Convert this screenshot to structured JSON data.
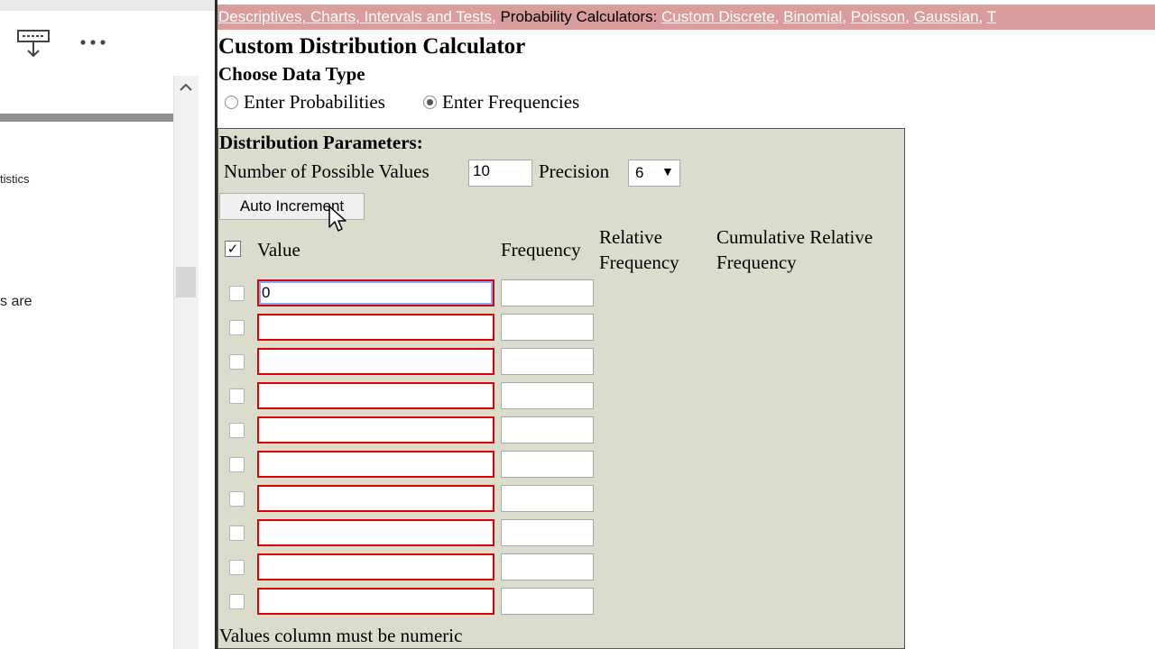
{
  "nav": {
    "link_descriptives": "Descriptives, Charts, Intervals and Tests",
    "prob_calc_label": "Probability Calculators:",
    "link_custom_discrete": "Custom Discrete",
    "link_binomial": "Binomial",
    "link_poisson": "Poisson",
    "link_gaussian": "Gaussian",
    "link_t": "T"
  },
  "page": {
    "title": "Custom Distribution Calculator",
    "data_type_heading": "Choose Data Type",
    "radio_probabilities": "Enter Probabilities",
    "radio_frequencies": "Enter Frequencies",
    "selected_data_type": "Enter Frequencies"
  },
  "params": {
    "heading": "Distribution Parameters:",
    "num_values_label": "Number of Possible Values",
    "num_values": "10",
    "precision_label": "Precision",
    "precision_value": "6",
    "auto_increment_label": "Auto Increment"
  },
  "table": {
    "header_checked": true,
    "col_value": "Value",
    "col_frequency": "Frequency",
    "col_relative_frequency": "Relative Frequency",
    "col_cumulative_relative_frequency": "Cumulative Relative Frequency",
    "rows": [
      {
        "value": "0",
        "frequency": ""
      },
      {
        "value": "",
        "frequency": ""
      },
      {
        "value": "",
        "frequency": ""
      },
      {
        "value": "",
        "frequency": ""
      },
      {
        "value": "",
        "frequency": ""
      },
      {
        "value": "",
        "frequency": ""
      },
      {
        "value": "",
        "frequency": ""
      },
      {
        "value": "",
        "frequency": ""
      },
      {
        "value": "",
        "frequency": ""
      },
      {
        "value": "",
        "frequency": ""
      }
    ]
  },
  "footer_note": "Values column must be numeric",
  "left_pane": {
    "fragment_1": "tistics",
    "fragment_2": "s are"
  },
  "icons": {
    "toolbar_download": "download-tray-icon",
    "toolbar_more": "more-horizontal-icon",
    "scroll_up": "chevron-up-icon",
    "cursor": "mouse-pointer-icon"
  },
  "colors": {
    "nav_bar": "#d99d9d",
    "panel_bg": "#dcdccc",
    "invalid_border": "#e00000"
  }
}
